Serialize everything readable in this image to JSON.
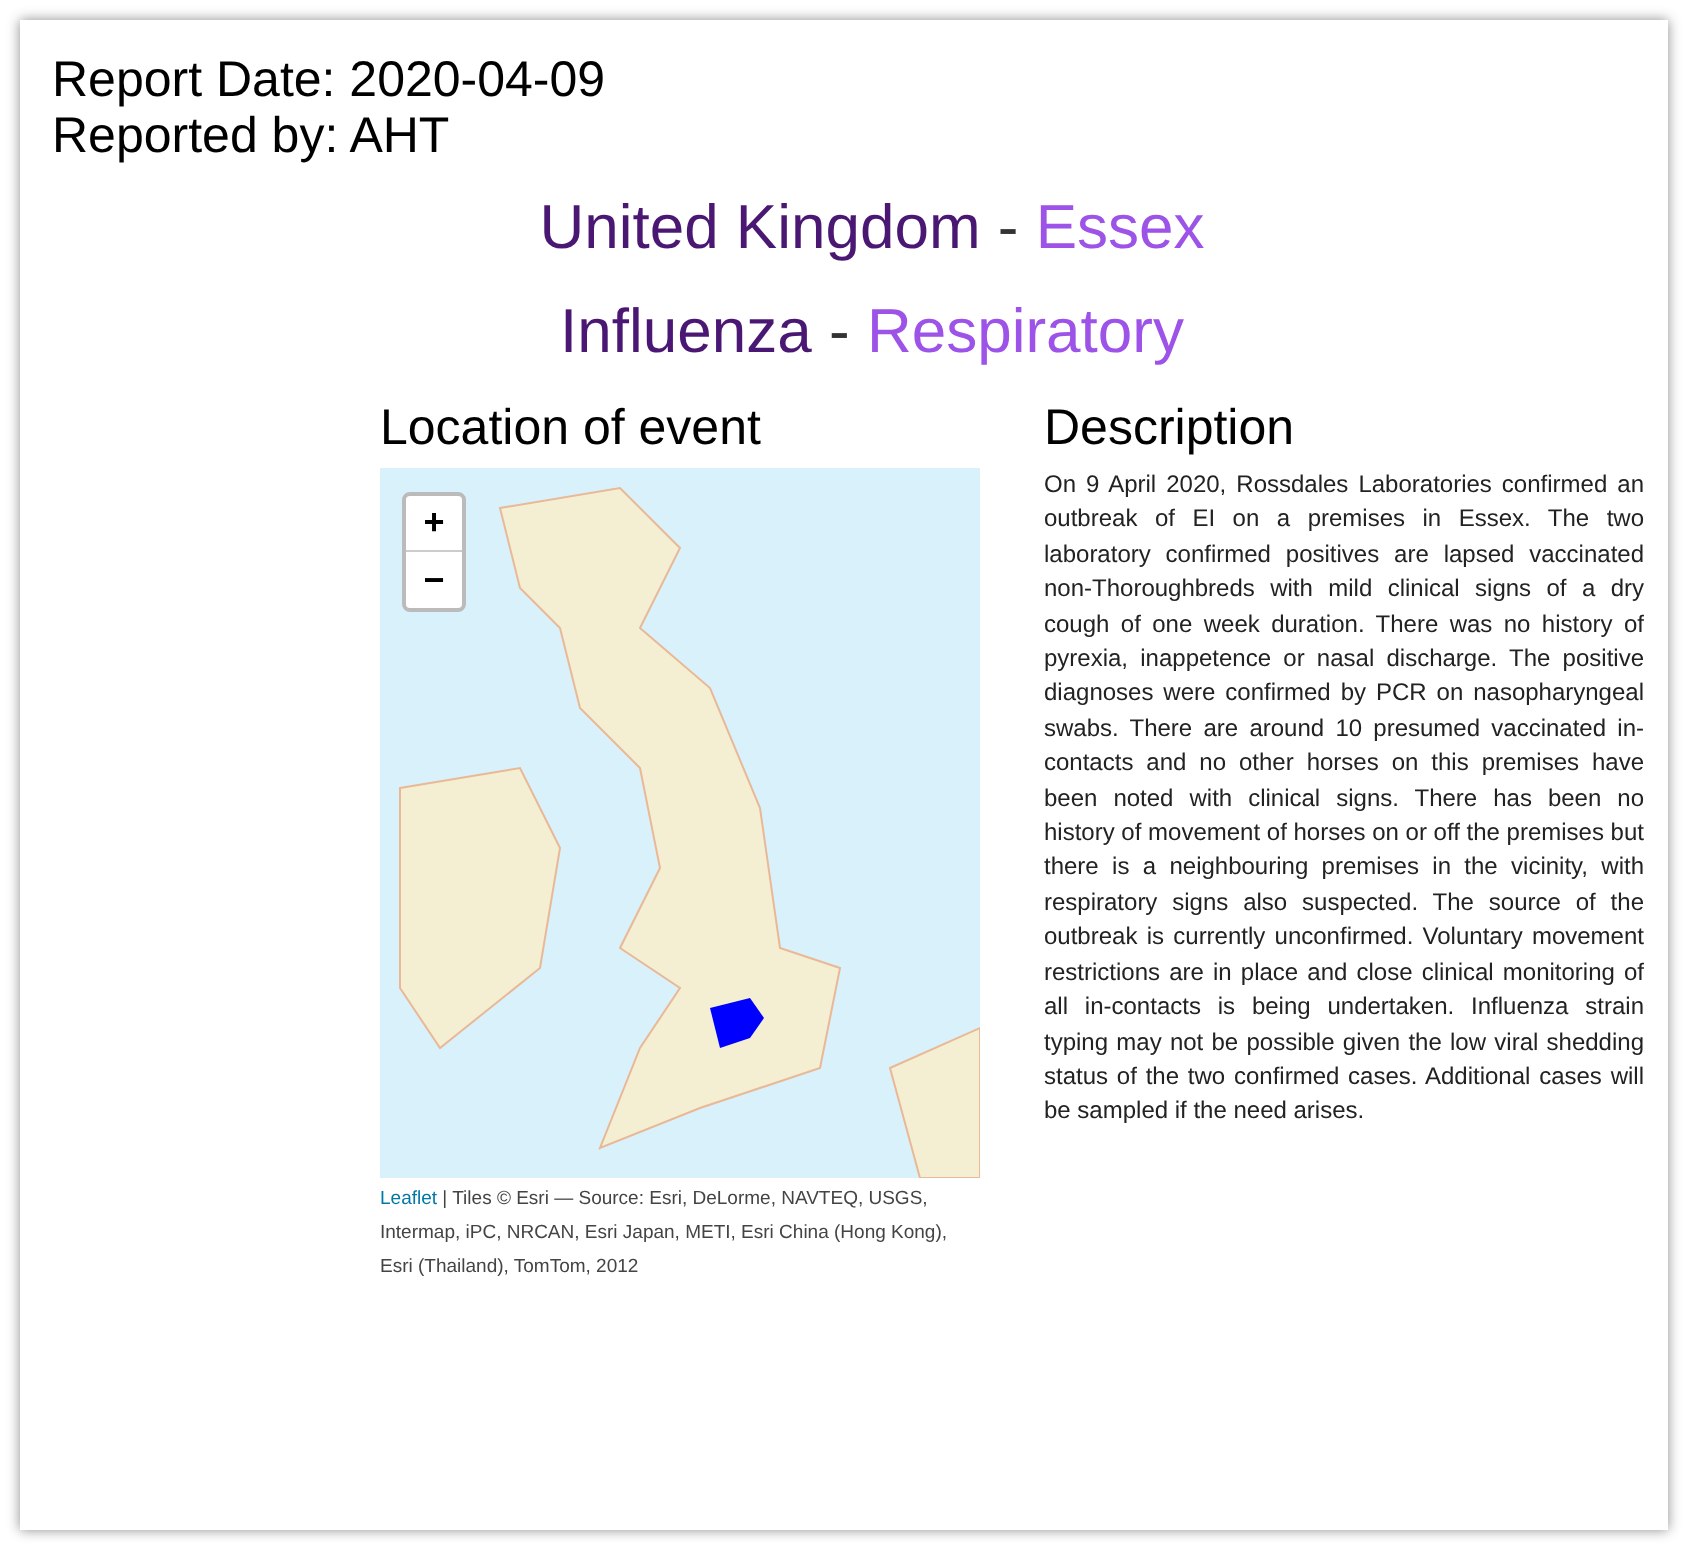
{
  "report": {
    "date_line": "Report Date: 2020-04-09",
    "reported_by_line": "Reported by: AHT"
  },
  "headings": [
    {
      "primary": "United Kingdom",
      "separator": "-",
      "secondary": "Essex"
    },
    {
      "primary": "Influenza",
      "separator": "-",
      "secondary": "Respiratory"
    }
  ],
  "location": {
    "title": "Location of event",
    "zoom_in": "+",
    "zoom_out": "−",
    "attribution_link": "Leaflet",
    "attribution": "| Tiles © Esri — Source: Esri, DeLorme, NAVTEQ, USGS, Intermap, iPC, NRCAN, Esri Japan, METI, Esri China (Hong Kong), Esri (Thailand), TomTom, 2012"
  },
  "description": {
    "title": "Description",
    "text": "On 9 April 2020, Rossdales Laboratories confirmed an outbreak of EI on a premises in Essex. The two laboratory confirmed positives are lapsed vaccinated non-Thoroughbreds with mild clinical signs of a dry cough of one week duration. There was no history of pyrexia, inappetence or nasal discharge. The positive diagnoses were confirmed by PCR on nasopharyngeal swabs. There are around 10 presumed vaccinated in-contacts and no other horses on this premises have been noted with clinical signs. There has been no history of movement of horses on or off the premises but there is a neighbouring premises in the vicinity, with respiratory signs also suspected. The source of the outbreak is currently unconfirmed. Voluntary movement restrictions are in place and close clinical monitoring of all in-contacts is being undertaken. Influenza strain typing may not be possible given the low viral shedding status of the two confirmed cases. Additional cases will be sampled if the need arises."
  }
}
